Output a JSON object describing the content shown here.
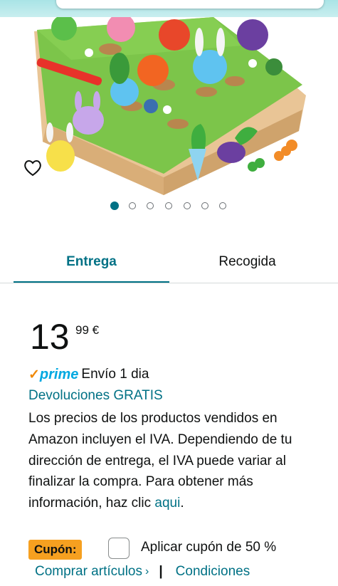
{
  "header": {
    "search_bar_icon": "search-bar"
  },
  "gallery": {
    "image_description_icon": "wooden-bunny-carrot-toy",
    "wishlist_icon": "heart-icon",
    "dot_count": 7,
    "active_dot": 0
  },
  "tabs": [
    {
      "label": "Entrega",
      "selected": true
    },
    {
      "label": "Recogida",
      "selected": false
    }
  ],
  "price": {
    "whole": "13",
    "fraction": "99 €"
  },
  "shipping": {
    "prime_check": "✓",
    "prime_label": "prime",
    "text": "Envío 1 dia"
  },
  "returns_label": "Devoluciones GRATIS",
  "vat": {
    "text": "Los precios de los productos vendidos en Amazon incluyen el IVA. Dependiendo de tu dirección de entrega, el IVA puede variar al finalizar la compra. Para obtener más información, haz clic ",
    "link": "aqui",
    "end": "."
  },
  "coupon": {
    "badge": "Cupón:",
    "label": "Aplicar cupón de 50 %",
    "checked": false
  },
  "links": {
    "shop": "Comprar artículos",
    "chevron": "›",
    "separator": "|",
    "conditions": "Condiciones"
  },
  "colors": {
    "link": "#007185",
    "prime_blue": "#00a8e1",
    "coupon_orange": "#f6a020",
    "check_orange": "#f08804"
  }
}
